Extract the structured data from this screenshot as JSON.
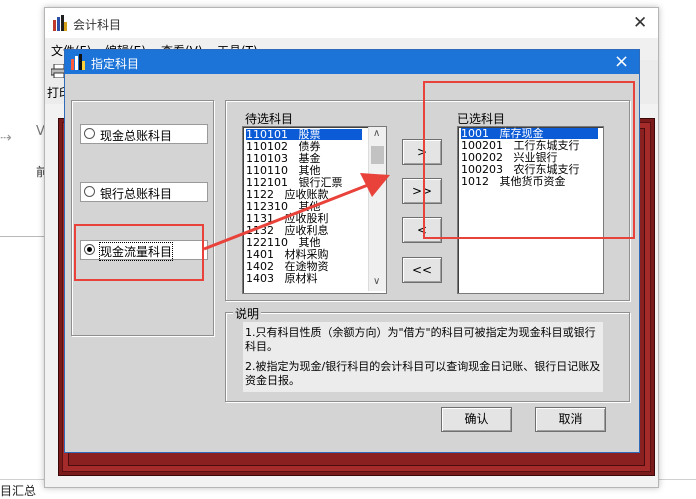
{
  "outer_window": {
    "title": "会计科目",
    "menu": [
      "文件(F)",
      "编辑(E)",
      "查看(V)",
      "工具(T)"
    ],
    "toolbar_label": "打印"
  },
  "background": {
    "left_letter": "V",
    "left_char": "前",
    "bottom_status": "目汇总"
  },
  "dialog": {
    "title": "指定科目",
    "close_glyph": "×",
    "options": [
      {
        "label": "现金总账科目",
        "selected": false
      },
      {
        "label": "银行总账科目",
        "selected": false
      },
      {
        "label": "现金流量科目",
        "selected": true
      }
    ],
    "pending_label": "待选科目",
    "pending_items": [
      {
        "code": "110101",
        "name": "股票",
        "selected": true
      },
      {
        "code": "110102",
        "name": "债券"
      },
      {
        "code": "110103",
        "name": "基金"
      },
      {
        "code": "110110",
        "name": "其他"
      },
      {
        "code": "112101",
        "name": "银行汇票"
      },
      {
        "code": "1122",
        "name": "应收账款"
      },
      {
        "code": "112310",
        "name": "其他"
      },
      {
        "code": "1131",
        "name": "应收股利"
      },
      {
        "code": "1132",
        "name": "应收利息"
      },
      {
        "code": "122110",
        "name": "其他"
      },
      {
        "code": "1401",
        "name": "材料采购"
      },
      {
        "code": "1402",
        "name": "在途物资"
      },
      {
        "code": "1403",
        "name": "原材料"
      }
    ],
    "buttons": {
      "move_one": ">",
      "move_all": ">>",
      "remove_one": "<",
      "remove_all": "<<",
      "ok": "确认",
      "cancel": "取消"
    },
    "chosen_label": "已选科目",
    "chosen_items": [
      {
        "code": "1001",
        "name": "库存现金",
        "selected": true
      },
      {
        "code": "100201",
        "name": "工行东城支行"
      },
      {
        "code": "100202",
        "name": "兴业银行"
      },
      {
        "code": "100203",
        "name": "农行东城支行"
      },
      {
        "code": "1012",
        "name": "其他货币资金"
      }
    ],
    "notes_label": "说明",
    "notes": [
      "1.只有科目性质（余额方向）为\"借方\"的科目可被指定为现金科目或银行科目。",
      "2.被指定为现金/银行科目的会计科目可以查询现金日记账、银行日记账及资金日报。"
    ]
  },
  "colors": {
    "dialog_titlebar": "#1c74d8",
    "selection": "#0b5bd7",
    "annotation": "#e8423a",
    "frame": "#8b2020"
  }
}
